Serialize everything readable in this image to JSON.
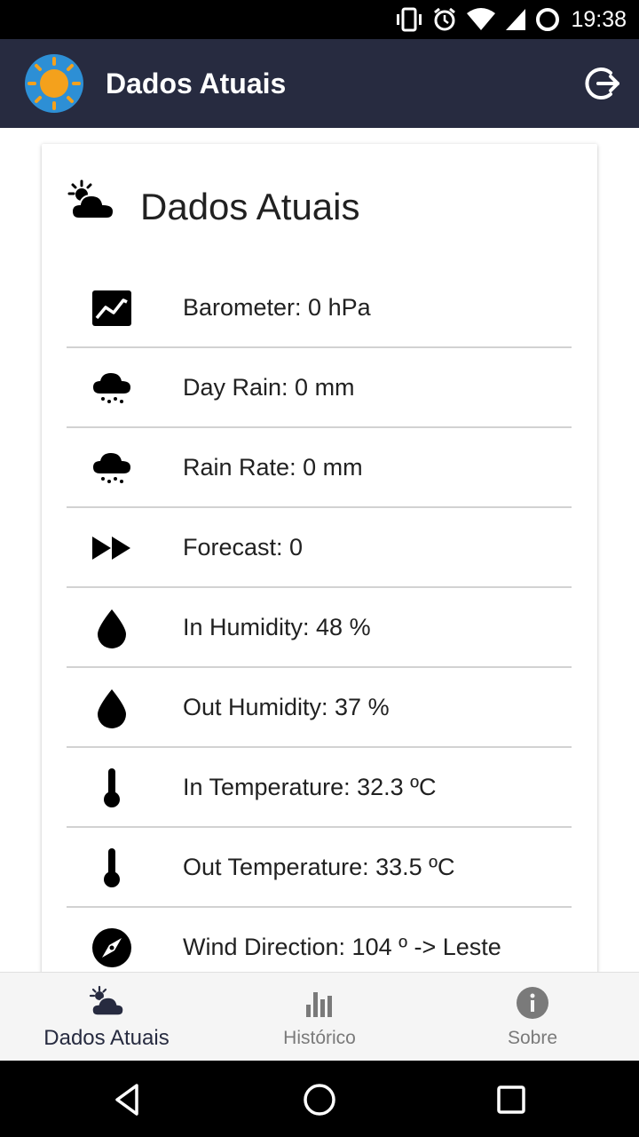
{
  "status_bar": {
    "time": "19:38",
    "icons": [
      "vibrate-icon",
      "alarm-icon",
      "wifi-icon",
      "signal-icon",
      "battery-icon"
    ]
  },
  "app_bar": {
    "title": "Dados Atuais",
    "logo_icon": "sun-logo-icon",
    "action_icon": "logout-icon",
    "background": "#272b40",
    "logo_color": "#f4a11c",
    "logo_bg": "#2d8fd5"
  },
  "card": {
    "title": "Dados Atuais",
    "header_icon": "partly-cloudy-icon",
    "rows": [
      {
        "icon": "barometer-chart-icon",
        "text": "Barometer: 0 hPa"
      },
      {
        "icon": "rain-cloud-icon",
        "text": "Day Rain: 0 mm"
      },
      {
        "icon": "rain-cloud-icon",
        "text": "Rain Rate: 0 mm"
      },
      {
        "icon": "fast-forward-icon",
        "text": "Forecast: 0"
      },
      {
        "icon": "water-drop-icon",
        "text": "In Humidity: 48 %"
      },
      {
        "icon": "water-drop-icon",
        "text": "Out Humidity: 37 %"
      },
      {
        "icon": "thermometer-icon",
        "text": "In Temperature: 32.3 ºC"
      },
      {
        "icon": "thermometer-icon",
        "text": "Out Temperature: 33.5 ºC"
      },
      {
        "icon": "compass-icon",
        "text": "Wind Direction: 104 º -> Leste"
      }
    ]
  },
  "bottom_nav": {
    "items": [
      {
        "label": "Dados Atuais",
        "icon": "partly-cloudy-icon",
        "active": true
      },
      {
        "label": "Histórico",
        "icon": "bar-chart-icon",
        "active": false
      },
      {
        "label": "Sobre",
        "icon": "info-icon",
        "active": false
      }
    ]
  },
  "system_nav": {
    "icons": [
      "back-icon",
      "home-icon",
      "recents-icon"
    ]
  }
}
